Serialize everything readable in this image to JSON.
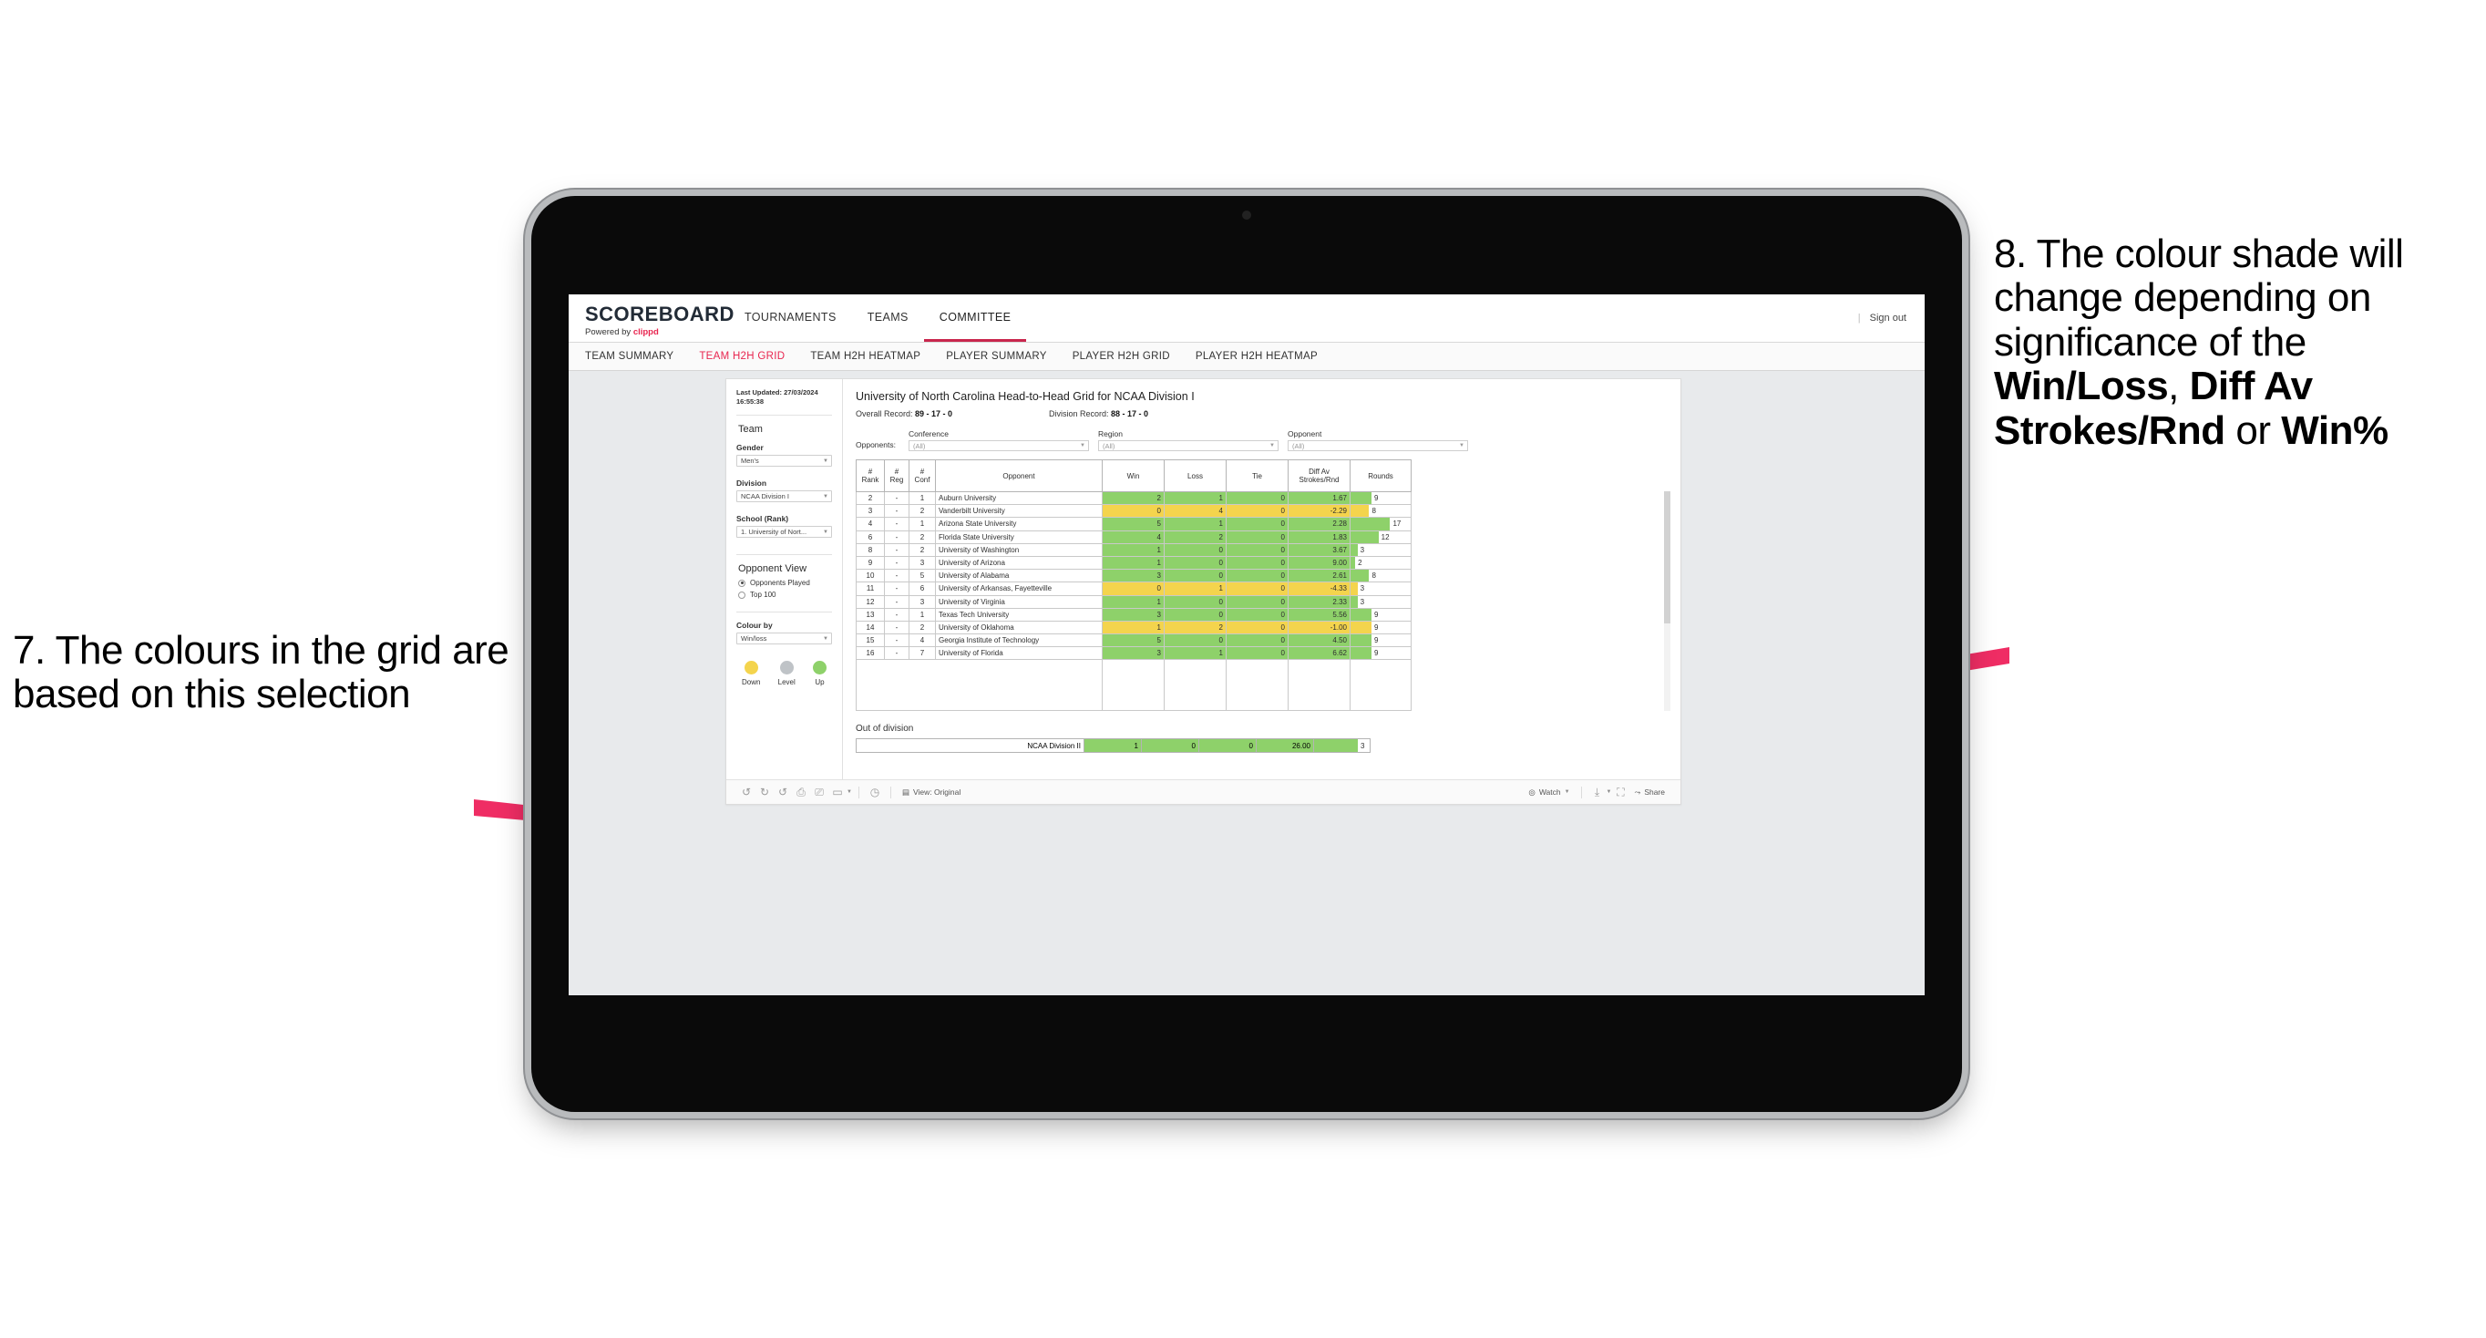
{
  "annotations": {
    "left": {
      "text": "7. The colours in the grid are based on this selection"
    },
    "right": {
      "line1": "8. The colour shade will change depending on significance of the ",
      "bold1": "Win/Loss",
      "mid1": ", ",
      "bold2": "Diff Av Strokes/Rnd",
      "mid2": " or ",
      "bold3": "Win%"
    },
    "arrow_color": "#ef2d64"
  },
  "app": {
    "brand_name": "SCOREBOARD",
    "brand_sub_prefix": "Powered by ",
    "brand_sub_name": "clippd",
    "accent": "#e8254f",
    "topnav": [
      {
        "label": "TOURNAMENTS",
        "active": false
      },
      {
        "label": "TEAMS",
        "active": false
      },
      {
        "label": "COMMITTEE",
        "active": true
      }
    ],
    "signout": "Sign out",
    "subnav": [
      {
        "label": "TEAM SUMMARY",
        "active": false
      },
      {
        "label": "TEAM H2H GRID",
        "active": true
      },
      {
        "label": "TEAM H2H HEATMAP",
        "active": false
      },
      {
        "label": "PLAYER SUMMARY",
        "active": false
      },
      {
        "label": "PLAYER H2H GRID",
        "active": false
      },
      {
        "label": "PLAYER H2H HEATMAP",
        "active": false
      }
    ]
  },
  "panel": {
    "last_updated_label": "Last Updated:",
    "last_updated_value": "27/03/2024 16:55:38",
    "team_title": "Team",
    "gender_label": "Gender",
    "gender_value": "Men's",
    "division_label": "Division",
    "division_value": "NCAA Division I",
    "school_label": "School (Rank)",
    "school_value": "1. University of Nort...",
    "opponent_view_title": "Opponent View",
    "radios": [
      {
        "label": "Opponents Played",
        "selected": true
      },
      {
        "label": "Top 100",
        "selected": false
      }
    ],
    "colour_by_label": "Colour by",
    "colour_by_value": "Win/loss",
    "legend": [
      {
        "label": "Down",
        "color": "#f4d44d"
      },
      {
        "label": "Level",
        "color": "#bfc3c7"
      },
      {
        "label": "Up",
        "color": "#8ed16a"
      }
    ]
  },
  "viz": {
    "title": "University of North Carolina Head-to-Head Grid for NCAA Division I",
    "overall_label": "Overall Record: ",
    "overall_value": "89 - 17 - 0",
    "division_label": "Division Record: ",
    "division_value": "88 - 17 - 0",
    "opponents_lead": "Opponents:",
    "filters": [
      {
        "label": "Conference",
        "value": "(All)"
      },
      {
        "label": "Region",
        "value": "(All)"
      },
      {
        "label": "Opponent",
        "value": "(All)"
      }
    ],
    "out_of_division_title": "Out of division",
    "toolbar": {
      "view_label": "View: Original",
      "watch_label": "Watch",
      "share_label": "Share"
    }
  },
  "chart_data": {
    "type": "table",
    "title": "University of North Carolina Head-to-Head Grid for NCAA Division I",
    "columns": [
      "# Rank",
      "# Reg",
      "# Conf",
      "Opponent",
      "Win",
      "Loss",
      "Tie",
      "Diff Av Strokes/Rnd",
      "Rounds"
    ],
    "colour_by": "Win/loss",
    "colour_scale": {
      "down": "#f4d44d",
      "level": "#bfc3c7",
      "up": "#8ed16a"
    },
    "rounds_axis_max": 18,
    "rows": [
      {
        "rank": "2",
        "reg": "-",
        "conf": "1",
        "opponent": "Auburn University",
        "win": "2",
        "loss": "1",
        "tie": "0",
        "diff": "1.67",
        "rounds": "9",
        "rounds_num": 9,
        "state": "up"
      },
      {
        "rank": "3",
        "reg": "-",
        "conf": "2",
        "opponent": "Vanderbilt University",
        "win": "0",
        "loss": "4",
        "tie": "0",
        "diff": "-2.29",
        "rounds": "8",
        "rounds_num": 8,
        "state": "down"
      },
      {
        "rank": "4",
        "reg": "-",
        "conf": "1",
        "opponent": "Arizona State University",
        "win": "5",
        "loss": "1",
        "tie": "0",
        "diff": "2.28",
        "rounds": "17",
        "rounds_num": 17,
        "state": "up"
      },
      {
        "rank": "6",
        "reg": "-",
        "conf": "2",
        "opponent": "Florida State University",
        "win": "4",
        "loss": "2",
        "tie": "0",
        "diff": "1.83",
        "rounds": "12",
        "rounds_num": 12,
        "state": "up"
      },
      {
        "rank": "8",
        "reg": "-",
        "conf": "2",
        "opponent": "University of Washington",
        "win": "1",
        "loss": "0",
        "tie": "0",
        "diff": "3.67",
        "rounds": "3",
        "rounds_num": 3,
        "state": "up"
      },
      {
        "rank": "9",
        "reg": "-",
        "conf": "3",
        "opponent": "University of Arizona",
        "win": "1",
        "loss": "0",
        "tie": "0",
        "diff": "9.00",
        "rounds": "2",
        "rounds_num": 2,
        "state": "up"
      },
      {
        "rank": "10",
        "reg": "-",
        "conf": "5",
        "opponent": "University of Alabama",
        "win": "3",
        "loss": "0",
        "tie": "0",
        "diff": "2.61",
        "rounds": "8",
        "rounds_num": 8,
        "state": "up"
      },
      {
        "rank": "11",
        "reg": "-",
        "conf": "6",
        "opponent": "University of Arkansas, Fayetteville",
        "win": "0",
        "loss": "1",
        "tie": "0",
        "diff": "-4.33",
        "rounds": "3",
        "rounds_num": 3,
        "state": "down"
      },
      {
        "rank": "12",
        "reg": "-",
        "conf": "3",
        "opponent": "University of Virginia",
        "win": "1",
        "loss": "0",
        "tie": "0",
        "diff": "2.33",
        "rounds": "3",
        "rounds_num": 3,
        "state": "up"
      },
      {
        "rank": "13",
        "reg": "-",
        "conf": "1",
        "opponent": "Texas Tech University",
        "win": "3",
        "loss": "0",
        "tie": "0",
        "diff": "5.56",
        "rounds": "9",
        "rounds_num": 9,
        "state": "up"
      },
      {
        "rank": "14",
        "reg": "-",
        "conf": "2",
        "opponent": "University of Oklahoma",
        "win": "1",
        "loss": "2",
        "tie": "0",
        "diff": "-1.00",
        "rounds": "9",
        "rounds_num": 9,
        "state": "down"
      },
      {
        "rank": "15",
        "reg": "-",
        "conf": "4",
        "opponent": "Georgia Institute of Technology",
        "win": "5",
        "loss": "0",
        "tie": "0",
        "diff": "4.50",
        "rounds": "9",
        "rounds_num": 9,
        "state": "up"
      },
      {
        "rank": "16",
        "reg": "-",
        "conf": "7",
        "opponent": "University of Florida",
        "win": "3",
        "loss": "1",
        "tie": "0",
        "diff": "6.62",
        "rounds": "9",
        "rounds_num": 9,
        "state": "up"
      }
    ],
    "out_of_division": [
      {
        "opponent": "NCAA Division II",
        "win": "1",
        "loss": "0",
        "tie": "0",
        "diff": "26.00",
        "rounds": "3",
        "rounds_num": 3,
        "state": "up"
      }
    ]
  }
}
